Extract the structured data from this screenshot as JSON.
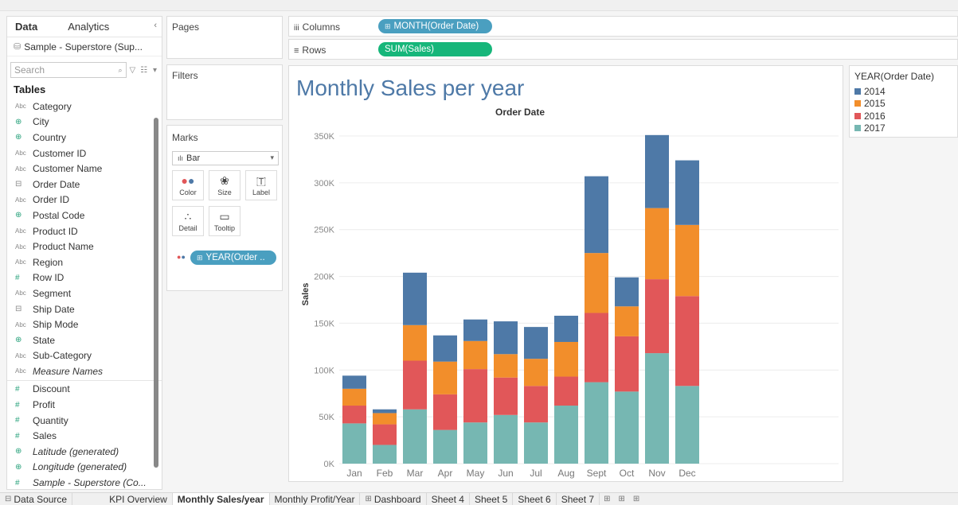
{
  "data_pane": {
    "tabs": [
      "Data",
      "Analytics"
    ],
    "collapse": "‹",
    "source": "Sample - Superstore (Sup...",
    "search_placeholder": "Search",
    "tables_heading": "Tables",
    "dimensions": [
      {
        "type": "Abc",
        "name": "Category"
      },
      {
        "type": "⊕",
        "name": "City"
      },
      {
        "type": "⊕",
        "name": "Country"
      },
      {
        "type": "Abc",
        "name": "Customer ID"
      },
      {
        "type": "Abc",
        "name": "Customer Name"
      },
      {
        "type": "⊟",
        "name": "Order Date"
      },
      {
        "type": "Abc",
        "name": "Order ID"
      },
      {
        "type": "⊕",
        "name": "Postal Code"
      },
      {
        "type": "Abc",
        "name": "Product ID"
      },
      {
        "type": "Abc",
        "name": "Product Name"
      },
      {
        "type": "Abc",
        "name": "Region"
      },
      {
        "type": "#",
        "name": "Row ID"
      },
      {
        "type": "Abc",
        "name": "Segment"
      },
      {
        "type": "⊟",
        "name": "Ship Date"
      },
      {
        "type": "Abc",
        "name": "Ship Mode"
      },
      {
        "type": "⊕",
        "name": "State"
      },
      {
        "type": "Abc",
        "name": "Sub-Category"
      },
      {
        "type": "Abc",
        "name": "Measure Names"
      }
    ],
    "measures": [
      {
        "type": "#",
        "name": "Discount"
      },
      {
        "type": "#",
        "name": "Profit"
      },
      {
        "type": "#",
        "name": "Quantity"
      },
      {
        "type": "#",
        "name": "Sales"
      },
      {
        "type": "⊕",
        "name": "Latitude (generated)"
      },
      {
        "type": "⊕",
        "name": "Longitude (generated)"
      },
      {
        "type": "#",
        "name": "Sample - Superstore (Co..."
      }
    ]
  },
  "pages_label": "Pages",
  "filters_label": "Filters",
  "marks": {
    "title": "Marks",
    "type": "Bar",
    "buttons": [
      {
        "label": "Color",
        "icon": "color-icon"
      },
      {
        "label": "Size",
        "icon": "size-icon"
      },
      {
        "label": "Label",
        "icon": "label-icon"
      },
      {
        "label": "Detail",
        "icon": "detail-icon"
      },
      {
        "label": "Tooltip",
        "icon": "tooltip-icon"
      }
    ],
    "color_pill": "YEAR(Order .."
  },
  "shelves": {
    "columns_label": "Columns",
    "columns_pill": "MONTH(Order Date)",
    "rows_label": "Rows",
    "rows_pill": "SUM(Sales)"
  },
  "view_title": "Monthly Sales per year",
  "legend": {
    "title": "YEAR(Order Date)",
    "items": [
      {
        "label": "2014",
        "color": "#4e79a7"
      },
      {
        "label": "2015",
        "color": "#f28e2b"
      },
      {
        "label": "2016",
        "color": "#e15759"
      },
      {
        "label": "2017",
        "color": "#76b7b2"
      }
    ]
  },
  "chart_data": {
    "type": "bar",
    "stacked": true,
    "title": "Order Date",
    "ylabel": "Sales",
    "ylim": [
      0,
      350000
    ],
    "yticks": [
      "0K",
      "50K",
      "100K",
      "150K",
      "200K",
      "250K",
      "300K",
      "350K"
    ],
    "categories": [
      "Jan",
      "Feb",
      "Mar",
      "Apr",
      "May",
      "Jun",
      "Jul",
      "Aug",
      "Sept",
      "Oct",
      "Nov",
      "Dec"
    ],
    "series": [
      {
        "name": "2017",
        "color": "#76b7b2",
        "values": [
          43000,
          20000,
          58000,
          36000,
          44000,
          52000,
          44000,
          62000,
          87000,
          77000,
          118000,
          83000
        ]
      },
      {
        "name": "2016",
        "color": "#e15759",
        "values": [
          19000,
          22000,
          52000,
          38000,
          57000,
          40000,
          39000,
          31000,
          74000,
          59000,
          79000,
          96000
        ]
      },
      {
        "name": "2015",
        "color": "#f28e2b",
        "values": [
          18000,
          12000,
          38000,
          35000,
          30000,
          25000,
          29000,
          37000,
          64000,
          32000,
          76000,
          76000
        ]
      },
      {
        "name": "2014",
        "color": "#4e79a7",
        "values": [
          14000,
          4000,
          56000,
          28000,
          23000,
          35000,
          34000,
          28000,
          82000,
          31000,
          78000,
          69000
        ]
      }
    ]
  },
  "bottom_tabs": [
    {
      "label": "Data Source",
      "icon": "⊟"
    },
    {
      "label": "KPI Overview"
    },
    {
      "label": "Monthly Sales/year",
      "active": true
    },
    {
      "label": "Monthly Profit/Year"
    },
    {
      "label": "Dashboard",
      "icon": "⊞"
    },
    {
      "label": "Sheet 4"
    },
    {
      "label": "Sheet 5"
    },
    {
      "label": "Sheet 6"
    },
    {
      "label": "Sheet 7"
    }
  ]
}
